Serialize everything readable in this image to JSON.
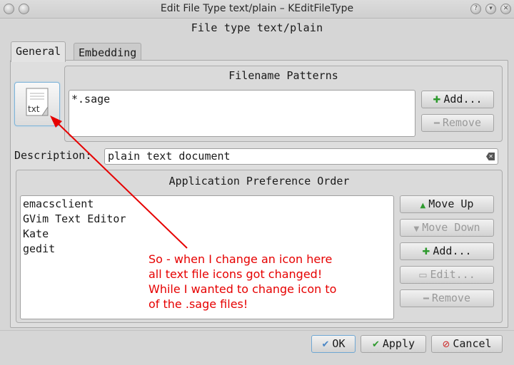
{
  "window": {
    "title": "Edit File Type text/plain – KEditFileType",
    "heading": "File type text/plain"
  },
  "tabs": [
    {
      "label": "General",
      "active": true
    },
    {
      "label": "Embedding",
      "active": false
    }
  ],
  "icon": {
    "label": "txt",
    "name": "text-file-icon"
  },
  "filename_patterns": {
    "title": "Filename Patterns",
    "items": [
      "*.sage"
    ],
    "add_label": "Add...",
    "remove_label": "Remove"
  },
  "description": {
    "label": "Description:",
    "value": "plain text document"
  },
  "app_pref": {
    "title": "Application Preference Order",
    "items": [
      "emacsclient",
      "GVim Text Editor",
      "Kate",
      "gedit"
    ],
    "move_up_label": "Move Up",
    "move_down_label": "Move Down",
    "add_label": "Add...",
    "edit_label": "Edit...",
    "remove_label": "Remove"
  },
  "annotation": {
    "lines": [
      "So - when I change an icon here",
      "all text file icons got changed!",
      "While I wanted to change icon to",
      "of the .sage files!"
    ],
    "color": "#e60000"
  },
  "footer": {
    "ok_label": "OK",
    "apply_label": "Apply",
    "cancel_label": "Cancel"
  }
}
